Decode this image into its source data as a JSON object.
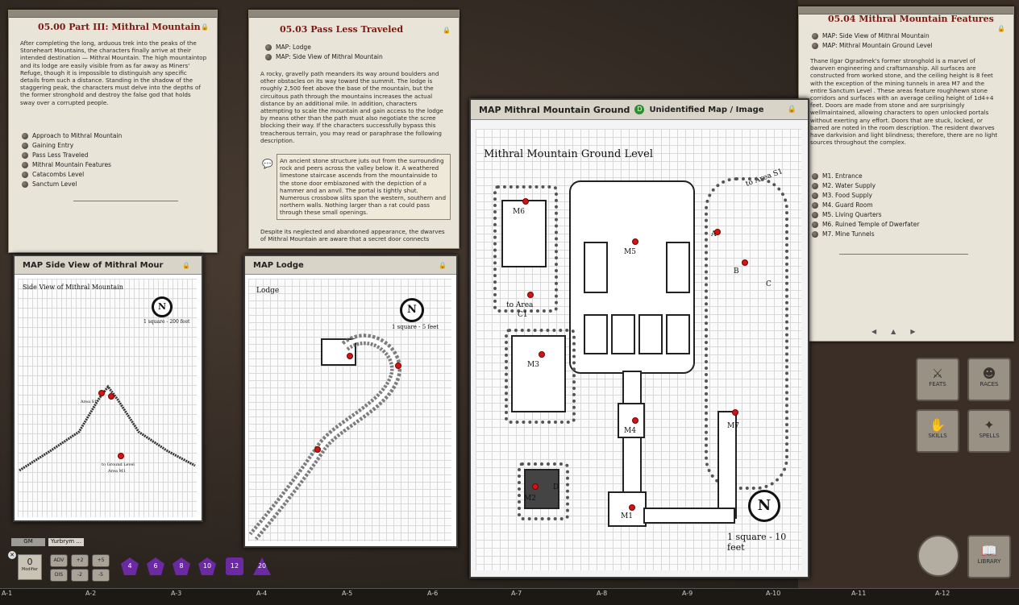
{
  "story_main": {
    "title": "05.00 Part III: Mithral Mountain",
    "body": "After completing the long, arduous trek into the peaks of the Stoneheart Mountains, the characters finally arrive at their intended destination — Mithral Mountain. The high mountaintop and its lodge are easily visible from as far away as Miners' Refuge, though it is impossible to distinguish any specific details from such a distance. Standing in the shadow of the staggering peak, the characters must delve into the depths of the former stronghold and destroy the false god that holds sway over a corrupted people.",
    "links": [
      "Approach to Mithral Mountain",
      "Gaining Entry",
      "Pass Less Traveled",
      "Mithral Mountain Features",
      "Catacombs Level",
      "Sanctum Level"
    ]
  },
  "story_pass": {
    "title": "05.03 Pass Less Traveled",
    "links": [
      "MAP: Lodge",
      "MAP: Side View of Mithral Mountain"
    ],
    "body": "A rocky, gravelly path meanders its way around boulders and other obstacles on its way toward the summit. The lodge is roughly 2,500 feet above the base of the mountain, but the circuitous path through the mountains increases the actual distance by an additional mile. In addition, characters attempting to scale the mountain and gain access to the lodge by means other than the path must also negotiate the scree blocking their way. If the characters successfully bypass this treacherous terrain, you may read or paraphrase the following description.",
    "boxed": "An ancient stone structure juts out from the surrounding rock and peers across the valley below it. A weathered limestone staircase ascends from the mountainside to the stone door emblazoned with the depiction of a hammer and an anvil. The portal is tightly shut. Numerous crossbow slits span the western, southern and northern walls. Nothing larger than a rat could pass through these small openings.",
    "tail": "Despite its neglected and abandoned appearance, the dwarves of Mithral Mountain are aware that a secret door connects"
  },
  "story_features": {
    "title": "05.04 Mithral Mountain Features",
    "links": [
      "MAP: Side View of Mithral Mountain",
      "MAP: Mithral Mountain Ground Level"
    ],
    "body": "Thane Ilgar Ogradmek's former stronghold is a marvel of dwarven engineering and craftsmanship. All surfaces are constructed from worked stone, and the ceiling height is 8 feet with the exception of the mining tunnels in area M7 and the entire Sanctum Level . These areas feature roughhewn stone corridors and surfaces with an average ceiling height of 1d4+4 feet. Doors are made from stone and are surprisingly wellmaintained, allowing characters to open unlocked portals without exerting any effort. Doors that are stuck, locked, or barred are noted in the room description. The resident dwarves have darkvision and light blindness; therefore, there are no light sources throughout the complex.",
    "areas": [
      "M1. Entrance",
      "M2. Water Supply",
      "M3. Food Supply",
      "M4. Guard Room",
      "M5. Living Quarters",
      "M6. Ruined Temple of Dwerfater",
      "M7. Mine Tunnels"
    ]
  },
  "map_side": {
    "header": "MAP Side View of Mithral Mour",
    "title": "Side View of Mithral Mountain",
    "scale": "1 square - 200 feet",
    "labels": [
      "Area S1",
      "to Ground Level",
      "Area M1"
    ]
  },
  "map_lodge": {
    "header": "MAP Lodge",
    "title": "Lodge",
    "scale": "1 square - 5 feet"
  },
  "map_ground": {
    "header": "MAP Mithral Mountain Ground",
    "badge": "Unidentified Map / Image",
    "title": "Mithral Mountain Ground Level",
    "scale": "1 square - 10 feet",
    "to_s1": "to Area S1",
    "areas": [
      "M6",
      "M5",
      "M3",
      "M4",
      "M2",
      "M1",
      "M7",
      "A",
      "B",
      "C",
      "D",
      "to Area",
      "C1"
    ]
  },
  "sidebar": {
    "buttons": [
      "FEATS",
      "RACES",
      "SKILLS",
      "SPELLS",
      "LIBRARY"
    ]
  },
  "chat": {
    "tabs": [
      "GM",
      "Yurbrym ..."
    ],
    "modifier_value": "0",
    "modifier_label": "Modifier",
    "buttons": [
      "ADV",
      "DIS",
      "+2",
      "+5",
      "-2",
      "-5"
    ],
    "dice": [
      "4",
      "6",
      "8",
      "10",
      "12",
      "20"
    ]
  },
  "grid_cols": [
    "A-1",
    "A-2",
    "A-3",
    "A-4",
    "A-5",
    "A-6",
    "A-7",
    "A-8",
    "A-9",
    "A-10",
    "A-11",
    "A-12"
  ],
  "compass_letter": "N"
}
